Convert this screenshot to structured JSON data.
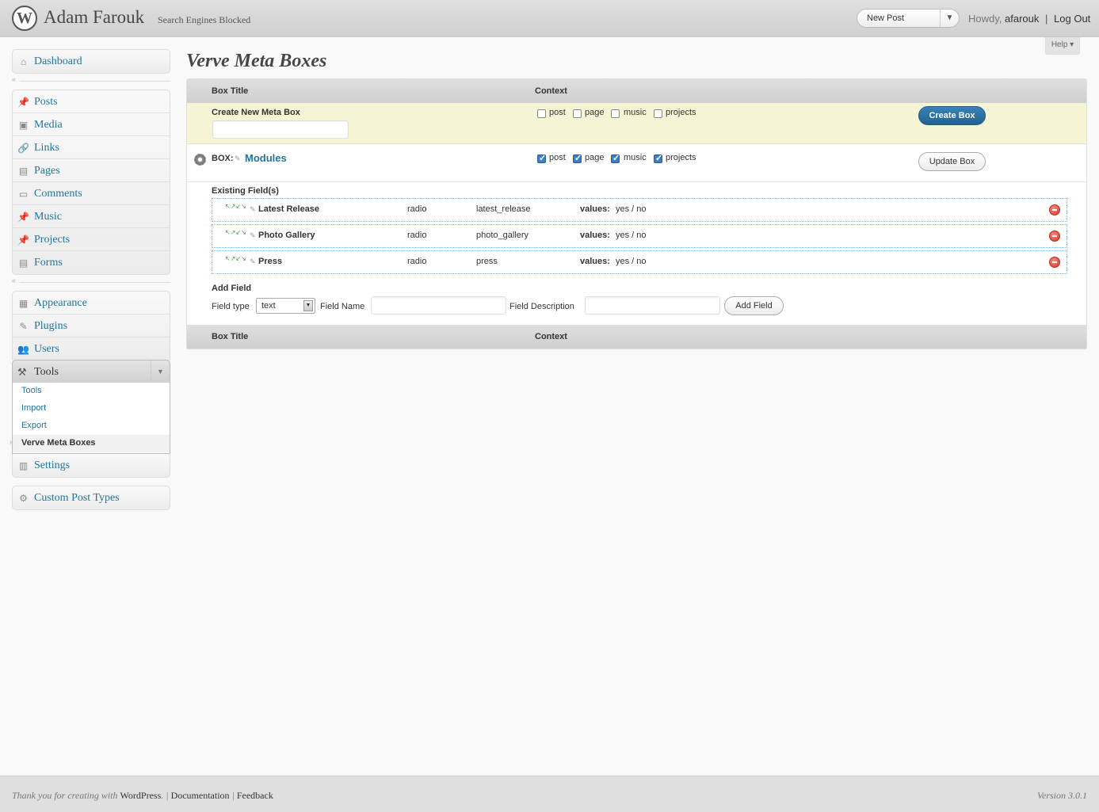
{
  "header": {
    "logo_glyph": "W",
    "site_title": "Adam Farouk",
    "site_subtitle": "Search Engines Blocked",
    "new_post_label": "New Post",
    "dropdown_glyph": "▼",
    "howdy_prefix": "Howdy,",
    "username": "afarouk",
    "separator": "|",
    "logout_label": "Log Out"
  },
  "help_tab": "Help ▾",
  "collapse_glyph": "«",
  "menu": {
    "group1": [
      {
        "label": "Dashboard",
        "icon": "⌂"
      }
    ],
    "group2": [
      {
        "label": "Posts",
        "icon": "📌"
      },
      {
        "label": "Media",
        "icon": "▣"
      },
      {
        "label": "Links",
        "icon": "🔗"
      },
      {
        "label": "Pages",
        "icon": "▤"
      },
      {
        "label": "Comments",
        "icon": "▭"
      },
      {
        "label": "Music",
        "icon": "📌"
      },
      {
        "label": "Projects",
        "icon": "📌"
      },
      {
        "label": "Forms",
        "icon": "▤"
      }
    ],
    "group3": [
      {
        "label": "Appearance",
        "icon": "▦"
      },
      {
        "label": "Plugins",
        "icon": "✎"
      },
      {
        "label": "Users",
        "icon": "👥"
      }
    ],
    "tools": {
      "label": "Tools",
      "icon": "⚒",
      "toggle_glyph": "▼",
      "current_marker": "›",
      "submenu": [
        "Tools",
        "Import",
        "Export",
        "Verve Meta Boxes"
      ],
      "current": "Verve Meta Boxes"
    },
    "settings": {
      "label": "Settings",
      "icon": "▥"
    },
    "custom_post_types": {
      "label": "Custom Post Types",
      "icon": "⚙"
    }
  },
  "page_title": "Verve Meta Boxes",
  "table": {
    "col_box_title": "Box Title",
    "col_context": "Context"
  },
  "create_row": {
    "label": "Create New Meta Box",
    "input_value": "",
    "contexts": [
      {
        "label": "post",
        "checked": false
      },
      {
        "label": "page",
        "checked": false
      },
      {
        "label": "music",
        "checked": false
      },
      {
        "label": "projects",
        "checked": false
      }
    ],
    "button": "Create Box"
  },
  "box_row": {
    "prefix": "BOX:",
    "edit_glyph": "✎",
    "name": "Modules",
    "contexts": [
      {
        "label": "post",
        "checked": true
      },
      {
        "label": "page",
        "checked": true
      },
      {
        "label": "music",
        "checked": true
      },
      {
        "label": "projects",
        "checked": true
      }
    ],
    "button": "Update Box"
  },
  "existing_fields": {
    "heading": "Existing Field(s)",
    "move_glyph": "↖↗↙↘",
    "values_label": "values:",
    "rows": [
      {
        "name": "Latest Release",
        "type": "radio",
        "key": "latest_release",
        "values": "yes / no"
      },
      {
        "name": "Photo Gallery",
        "type": "radio",
        "key": "photo_gallery",
        "values": "yes / no"
      },
      {
        "name": "Press",
        "type": "radio",
        "key": "press",
        "values": "yes / no"
      }
    ]
  },
  "add_field": {
    "heading": "Add Field",
    "type_label": "Field type",
    "type_value": "text",
    "select_glyph": "▼",
    "name_label": "Field Name",
    "name_value": "",
    "desc_label": "Field Description",
    "desc_value": "",
    "button": "Add Field"
  },
  "footer": {
    "thanks_prefix": "Thank you for creating with",
    "wordpress_link": "WordPress",
    "sep1": ". |",
    "documentation": "Documentation",
    "sep2": "|",
    "feedback": "Feedback",
    "version": "Version 3.0.1"
  }
}
